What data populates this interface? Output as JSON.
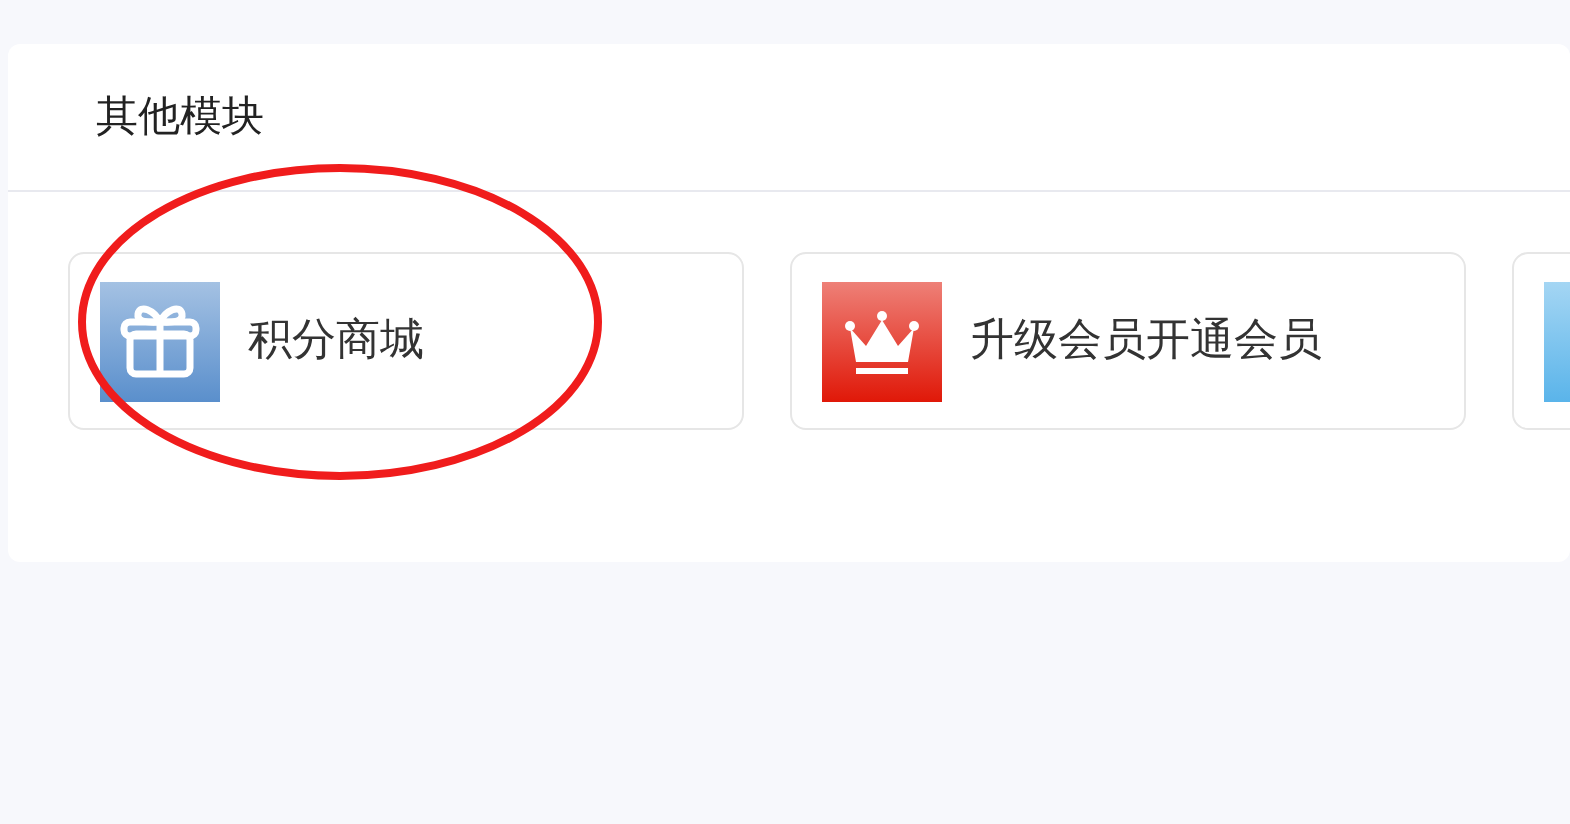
{
  "panel": {
    "title": "其他模块"
  },
  "tiles": [
    {
      "kind": "gift",
      "color": "#5a8fcc",
      "label": "积分商城",
      "circled": true
    },
    {
      "kind": "crown",
      "color": "#e01808",
      "label": "升级会员开通会员",
      "circled": false
    },
    {
      "kind": "blank",
      "color": "#5ab4ea",
      "circled": false
    }
  ]
}
